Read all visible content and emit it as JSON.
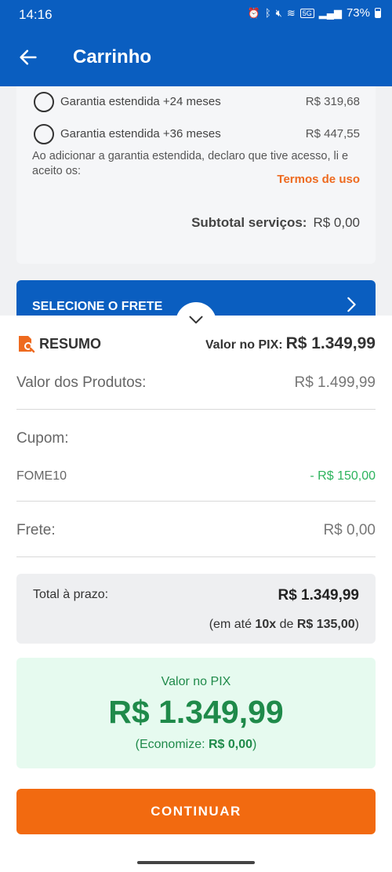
{
  "status_bar": {
    "time": "14:16",
    "network": "5G",
    "battery": "73%"
  },
  "app_bar": {
    "title": "Carrinho"
  },
  "warranty": {
    "options": [
      {
        "label": "Garantia estendida +24 meses",
        "price": "R$ 319,68"
      },
      {
        "label": "Garantia estendida +36 meses",
        "price": "R$ 447,55"
      }
    ],
    "declaration": "Ao adicionar a garantia estendida, declaro que tive acesso, li e aceito os:",
    "terms_link": "Termos de uso",
    "subtotal_label": "Subtotal serviços:",
    "subtotal_value": "R$ 0,00"
  },
  "frete": {
    "label": "SELECIONE O FRETE"
  },
  "summary": {
    "title": "RESUMO",
    "pix_label": "Valor no PIX:",
    "pix_value": "R$ 1.349,99",
    "products_label": "Valor dos Produtos:",
    "products_value": "R$ 1.499,99",
    "coupon_label": "Cupom:",
    "coupon_code": "FOME10",
    "coupon_value": "- R$ 150,00",
    "shipping_label": "Frete:",
    "shipping_value": "R$ 0,00",
    "total_label": "Total à prazo:",
    "total_value": "R$ 1.349,99",
    "installments_prefix": "(em até",
    "installments_count": "10x",
    "installments_mid": "de",
    "installments_value": "R$ 135,00",
    "installments_suffix": ")",
    "pix_box_label": "Valor no PIX",
    "pix_box_value": "R$ 1.349,99",
    "save_prefix": "(Economize:",
    "save_value": "R$ 0,00",
    "save_suffix": ")",
    "continue_label": "CONTINUAR"
  },
  "colors": {
    "brand_blue": "#0a5ec0",
    "accent_orange": "#f26a10",
    "pix_green": "#1f8a4a"
  }
}
